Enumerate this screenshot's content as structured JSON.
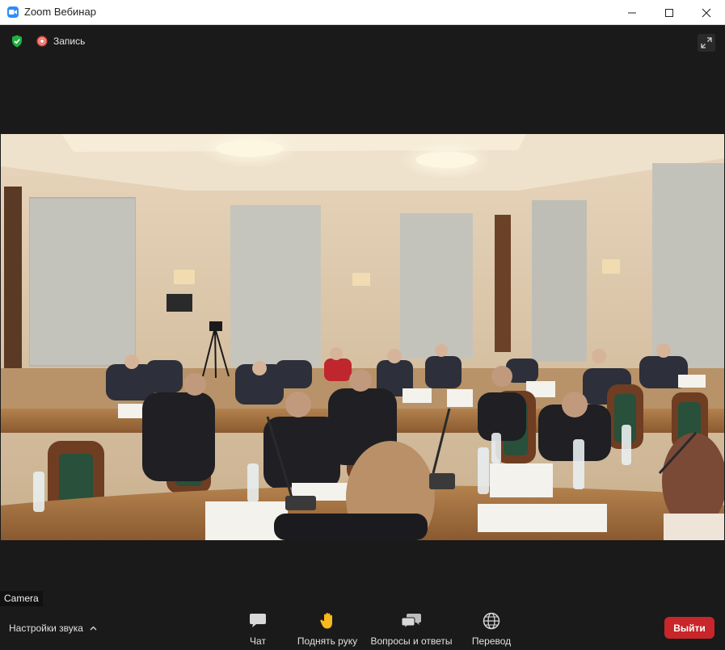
{
  "window": {
    "title": "Zoom Вебинар",
    "icons": {
      "app": "zoom-app-icon",
      "minimize": "minimize-icon",
      "maximize": "maximize-icon",
      "close": "close-icon"
    }
  },
  "top_bar": {
    "security_icon": "shield-check-icon",
    "recording": {
      "icon": "recording-icon",
      "label": "Запись"
    },
    "fullscreen_icon": "fullscreen-icon"
  },
  "video": {
    "label": "Camera"
  },
  "toolbar": {
    "audio_settings": {
      "label": "Настройки звука",
      "icon": "chevron-up-icon"
    },
    "items": [
      {
        "label": "Чат",
        "icon": "chat-icon"
      },
      {
        "label": "Поднять руку",
        "icon": "raise-hand-icon"
      },
      {
        "label": "Вопросы и ответы",
        "icon": "qa-icon"
      },
      {
        "label": "Перевод",
        "icon": "globe-icon"
      }
    ],
    "leave_label": "Выйти"
  },
  "colors": {
    "accent": "#2d8cff",
    "leave": "#c8262a",
    "background": "#1a1a1a",
    "security": "#1fb141"
  }
}
